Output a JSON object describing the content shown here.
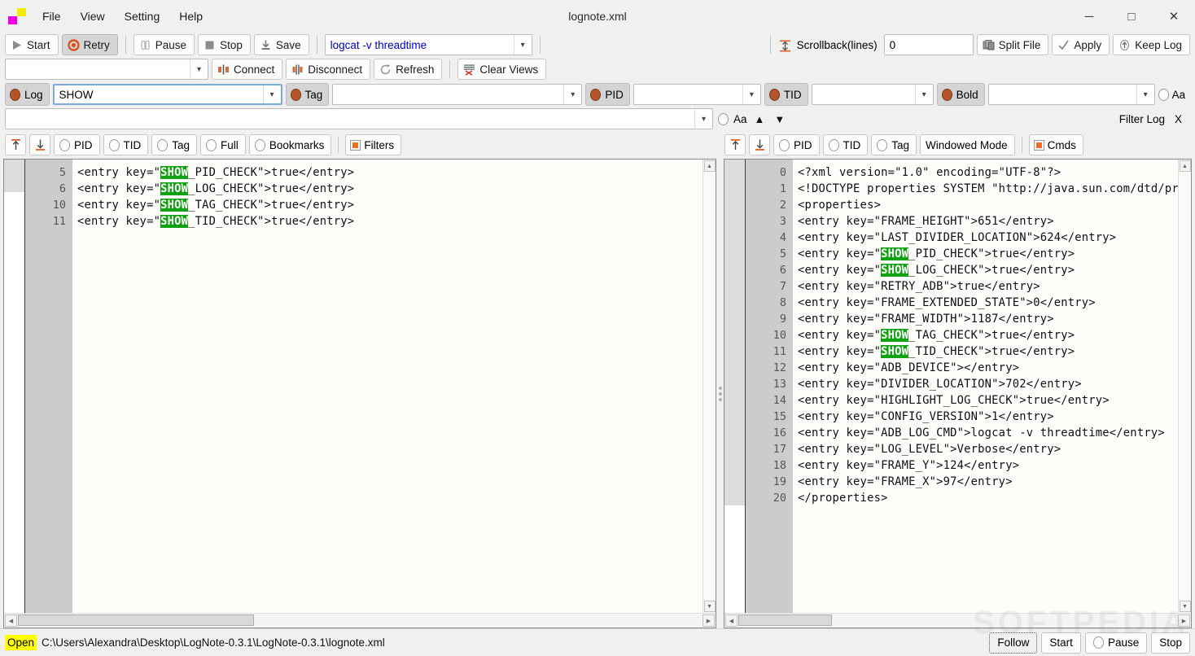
{
  "window": {
    "title": "lognote.xml",
    "minimize": "─",
    "maximize": "□",
    "close": "✕"
  },
  "menubar": {
    "items": [
      "File",
      "View",
      "Setting",
      "Help"
    ]
  },
  "toolbar_row1": {
    "start": "Start",
    "retry": "Retry",
    "pause": "Pause",
    "stop": "Stop",
    "save": "Save",
    "command_value": "logcat -v threadtime",
    "scrollback_label": "Scrollback(lines)",
    "scrollback_value": "0",
    "split_file": "Split File",
    "apply": "Apply",
    "keep_log": "Keep Log"
  },
  "toolbar_row2": {
    "device_value": "",
    "connect": "Connect",
    "disconnect": "Disconnect",
    "refresh": "Refresh",
    "clear_views": "Clear Views"
  },
  "filter_row": {
    "log_label": "Log",
    "log_value": "SHOW",
    "tag_label": "Tag",
    "tag_value": "",
    "pid_label": "PID",
    "pid_value": "",
    "tid_label": "TID",
    "tid_value": "",
    "bold_label": "Bold",
    "bold_value": "",
    "case_label": "Aa"
  },
  "filter_row2": {
    "find_value": "",
    "case_label": "Aa",
    "up": "▲",
    "down": "▼",
    "filter_log": "Filter Log",
    "close": "X"
  },
  "view_options_left": {
    "scroll_top_icon": "scroll-to-top-icon",
    "scroll_bottom_icon": "scroll-to-bottom-icon",
    "pid": "PID",
    "tid": "TID",
    "tag": "Tag",
    "full": "Full",
    "bookmarks": "Bookmarks",
    "filters": "Filters"
  },
  "view_options_right": {
    "pid": "PID",
    "tid": "TID",
    "tag": "Tag",
    "windowed_mode": "Windowed Mode",
    "cmds": "Cmds"
  },
  "left_pane": {
    "line_numbers": [
      "5",
      "6",
      "10",
      "11"
    ],
    "lines": [
      {
        "pre": "<entry key=\"",
        "hl": "SHOW",
        "post": "_PID_CHECK\">true</entry>"
      },
      {
        "pre": "<entry key=\"",
        "hl": "SHOW",
        "post": "_LOG_CHECK\">true</entry>"
      },
      {
        "pre": "<entry key=\"",
        "hl": "SHOW",
        "post": "_TAG_CHECK\">true</entry>"
      },
      {
        "pre": "<entry key=\"",
        "hl": "SHOW",
        "post": "_TID_CHECK\">true</entry>"
      }
    ]
  },
  "right_pane": {
    "line_numbers": [
      "0",
      "1",
      "2",
      "3",
      "4",
      "5",
      "6",
      "7",
      "8",
      "9",
      "10",
      "11",
      "12",
      "13",
      "14",
      "15",
      "16",
      "17",
      "18",
      "19",
      "20"
    ],
    "lines": [
      {
        "pre": "<?xml version=\"1.0\" encoding=\"UTF-8\"?>",
        "hl": "",
        "post": ""
      },
      {
        "pre": "<!DOCTYPE properties SYSTEM \"http://java.sun.com/dtd/properties.dtd\">",
        "hl": "",
        "post": ""
      },
      {
        "pre": "<properties>",
        "hl": "",
        "post": ""
      },
      {
        "pre": "<entry key=\"FRAME_HEIGHT\">651</entry>",
        "hl": "",
        "post": ""
      },
      {
        "pre": "<entry key=\"LAST_DIVIDER_LOCATION\">624</entry>",
        "hl": "",
        "post": ""
      },
      {
        "pre": "<entry key=\"",
        "hl": "SHOW",
        "post": "_PID_CHECK\">true</entry>"
      },
      {
        "pre": "<entry key=\"",
        "hl": "SHOW",
        "post": "_LOG_CHECK\">true</entry>"
      },
      {
        "pre": "<entry key=\"RETRY_ADB\">true</entry>",
        "hl": "",
        "post": ""
      },
      {
        "pre": "<entry key=\"FRAME_EXTENDED_STATE\">0</entry>",
        "hl": "",
        "post": ""
      },
      {
        "pre": "<entry key=\"FRAME_WIDTH\">1187</entry>",
        "hl": "",
        "post": ""
      },
      {
        "pre": "<entry key=\"",
        "hl": "SHOW",
        "post": "_TAG_CHECK\">true</entry>"
      },
      {
        "pre": "<entry key=\"",
        "hl": "SHOW",
        "post": "_TID_CHECK\">true</entry>"
      },
      {
        "pre": "<entry key=\"ADB_DEVICE\"></entry>",
        "hl": "",
        "post": ""
      },
      {
        "pre": "<entry key=\"DIVIDER_LOCATION\">702</entry>",
        "hl": "",
        "post": ""
      },
      {
        "pre": "<entry key=\"HIGHLIGHT_LOG_CHECK\">true</entry>",
        "hl": "",
        "post": ""
      },
      {
        "pre": "<entry key=\"CONFIG_VERSION\">1</entry>",
        "hl": "",
        "post": ""
      },
      {
        "pre": "<entry key=\"ADB_LOG_CMD\">logcat -v threadtime</entry>",
        "hl": "",
        "post": ""
      },
      {
        "pre": "<entry key=\"LOG_LEVEL\">Verbose</entry>",
        "hl": "",
        "post": ""
      },
      {
        "pre": "<entry key=\"FRAME_Y\">124</entry>",
        "hl": "",
        "post": ""
      },
      {
        "pre": "<entry key=\"FRAME_X\">97</entry>",
        "hl": "",
        "post": ""
      },
      {
        "pre": "</properties>",
        "hl": "",
        "post": ""
      }
    ]
  },
  "statusbar": {
    "open_label": "Open",
    "path": "C:\\Users\\Alexandra\\Desktop\\LogNote-0.3.1\\LogNote-0.3.1\\lognote.xml",
    "follow": "Follow",
    "start": "Start",
    "pause": "Pause",
    "stop": "Stop"
  },
  "watermark": "SOFTPEDIA",
  "colors": {
    "accent_orange": "#f26b21",
    "dot_brown": "#b4552c",
    "highlight_green": "#12a112",
    "command_blue": "#0000cc",
    "open_yellow": "#ffff00"
  }
}
